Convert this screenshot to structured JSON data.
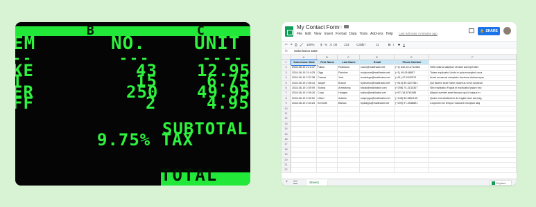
{
  "terminal": {
    "col_b": "B",
    "col_c": "C",
    "header_left": "EM",
    "header_mid": "NO.",
    "header_right": "UNIT",
    "dash_left": "--",
    "dash_mid": "---",
    "dash_right": "----",
    "rows": [
      {
        "item": "KE",
        "qty": "43",
        "unit": "12.95"
      },
      {
        "item": "T",
        "qty": "15",
        "unit": "6.75"
      },
      {
        "item": "ER",
        "qty": "250",
        "unit": "49.95"
      },
      {
        "item": "FF",
        "qty": "2",
        "unit": "4.95"
      }
    ],
    "subtotal": "SUBTOTAL",
    "tax": "9.75% TAX",
    "total": "TOTAL"
  },
  "sheet": {
    "title": "My Contact Form",
    "menu": [
      "File",
      "Edit",
      "View",
      "Insert",
      "Format",
      "Data",
      "Tools",
      "Add-ons",
      "Help"
    ],
    "last_edit": "Last edit was 4 minutes ago",
    "share_label": "SHARE",
    "toolbar": {
      "zoom": "100%",
      "currency": "$",
      "percent": "%",
      "decimals": ".0  .00",
      "format": "123",
      "font": "Calibri",
      "size": "11",
      "bold": "B",
      "italic": "I",
      "strike": "S",
      "color": "A"
    },
    "formula_bar_label": "fx",
    "formula_bar_value": "Submission Date",
    "columns": [
      "A",
      "B",
      "C",
      "D",
      "E",
      "F"
    ],
    "headers": [
      "Submission Date",
      "First Name",
      "Last Name",
      "Email",
      "Phone Number",
      ""
    ],
    "rows": [
      [
        "2018-06-19 2:12:47",
        "Fallon",
        "Robinson",
        "cuwo@mailinator.net",
        "(+1) 642-42-4712564",
        "Velit nostrud adipisci veniam ad imperdiet"
      ],
      [
        "2018-06-19 2:14:25",
        "Olga",
        "Fletcher",
        "wudyvom@mailinator.net",
        "(+1) 49-9168807",
        "Totam explicabo Unde in quia excepturi occa"
      ],
      [
        "2018-06-19 2:37:38",
        "Caesar",
        "York",
        "wodelege@mailinator.net",
        "(+61) 47-5342374",
        "Amet occaecat voluptate ducimus doloremque"
      ],
      [
        "2018-06-19 2:38:44",
        "Jasper",
        "Burton",
        "byleshivo@mailinator.net",
        "(+610) 89-6227561",
        "Qui facere esse harm ducimus ut sit occaeca"
      ],
      [
        "2018-06-19 2:39:09",
        "Shana",
        "Armstrong",
        "tobak@mailinator.com",
        "(+298) 74-3144307",
        "Sint explicabo Fugiat in explicabo ipsam exc"
      ],
      [
        "2018-06-19 2:39:34",
        "Cody",
        "Hodges",
        "todiso@mailinator.net",
        "(+67) 18-8761985",
        "Aliquid eveniet amet tempor qui id saque in"
      ],
      [
        "2018-06-19 2:39:52",
        "Oliver",
        "Adams",
        "suqevygo@mailinator.net",
        "(+145) 83-6661145",
        "Quam exercitationem do fugiat esse ad mag"
      ],
      [
        "2018-06-19 2:40:25",
        "Kenneth",
        "Barlow",
        "bydidyys@mailinator.net",
        "(+299) 97-4548891",
        "Corporis non tempor incidunt excepturi aliq"
      ]
    ],
    "row_count": 22,
    "sheet_tab": "Sheet1",
    "explore": "Explore"
  }
}
